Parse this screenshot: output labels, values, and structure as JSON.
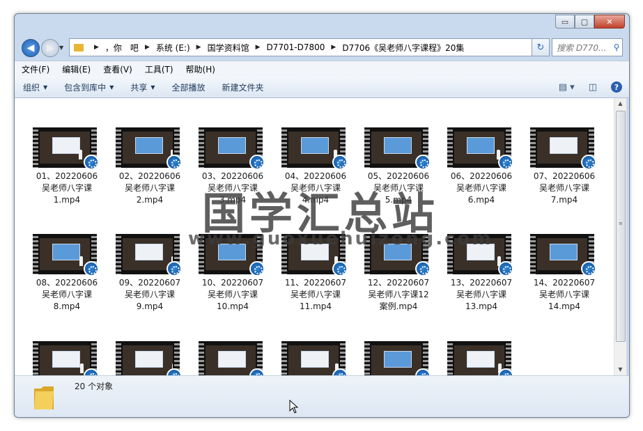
{
  "window": {
    "controls": {
      "minimize": "▭",
      "maximize": "▢",
      "close": "✕"
    }
  },
  "nav": {
    "back_icon": "◀",
    "forward_icon": "▶",
    "breadcrumbs": [
      "，你　吧",
      "系统 (E:)",
      "国学资料馆",
      "D7701-D7800",
      "D7706《吴老师八字课程》20集"
    ],
    "search_placeholder": "搜索 D770...",
    "refresh_icon": "↻",
    "search_icon": "🔍"
  },
  "menu": [
    "文件(F)",
    "编辑(E)",
    "查看(V)",
    "工具(T)",
    "帮助(H)"
  ],
  "toolbar": {
    "organize": "组织",
    "include_library": "包含到库中",
    "share": "共享",
    "play_all": "全部播放",
    "new_folder": "新建文件夹",
    "help_icon": "?"
  },
  "files": [
    {
      "label": "01、20220606\n吴老师八字课\n1.mp4",
      "screen": "white"
    },
    {
      "label": "02、20220606\n吴老师八字课\n2.mp4",
      "screen": "blue"
    },
    {
      "label": "03、20220606\n吴老师八字课\n3.mp4",
      "screen": "blue"
    },
    {
      "label": "04、20220606\n吴老师八字课\n4.mp4",
      "screen": "blue"
    },
    {
      "label": "05、20220606\n吴老师八字课\n5.mp4",
      "screen": "blue"
    },
    {
      "label": "06、20220606\n吴老师八字课\n6.mp4",
      "screen": "blue"
    },
    {
      "label": "07、20220606\n吴老师八字课\n7.mp4",
      "screen": "white"
    },
    {
      "label": "08、20220606\n吴老师八字课\n8.mp4",
      "screen": "blue"
    },
    {
      "label": "09、20220607\n吴老师八字课\n9.mp4",
      "screen": "white"
    },
    {
      "label": "10、20220607\n吴老师八字课\n10.mp4",
      "screen": "blue"
    },
    {
      "label": "11、20220607\n吴老师八字课\n11.mp4",
      "screen": "white"
    },
    {
      "label": "12、20220607\n吴老师八字课12\n案例.mp4",
      "screen": "blue"
    },
    {
      "label": "13、20220607\n吴老师八字课\n13.mp4",
      "screen": "white"
    },
    {
      "label": "14、20220607\n吴老师八字课\n14.mp4",
      "screen": "blue"
    },
    {
      "label": "",
      "screen": "white"
    },
    {
      "label": "",
      "screen": "white"
    },
    {
      "label": "",
      "screen": "white"
    },
    {
      "label": "",
      "screen": "white"
    },
    {
      "label": "",
      "screen": "blue"
    },
    {
      "label": "",
      "screen": "white"
    }
  ],
  "watermark": {
    "text": "国学汇总站",
    "url": "www.guoxuehuizong.com"
  },
  "status": {
    "count": "20 个对象"
  }
}
